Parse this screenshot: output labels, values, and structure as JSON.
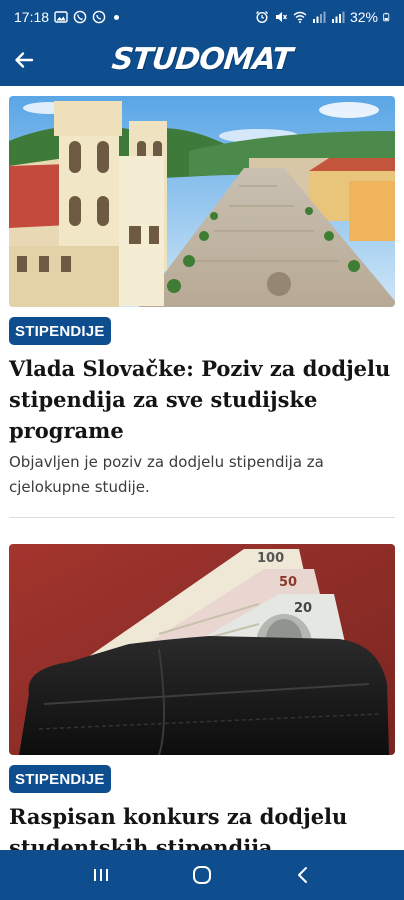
{
  "status_bar": {
    "time": "17:18",
    "battery": "32%"
  },
  "app_bar": {
    "logo_text": "STUDOMAT",
    "back_icon": "arrow-left-icon"
  },
  "articles": [
    {
      "category": "STIPENDIJE",
      "title": "Vlada Slovačke: Poziv za dodjelu stipendija za sve studijske programe",
      "excerpt": "Objavljen je poziv za dodjelu stipendija za cjelokupne studije.",
      "image": "town-square-photo"
    },
    {
      "category": "STIPENDIJE",
      "title": "Raspisan konkurs za dodjelu studentskih stipendija",
      "excerpt": "",
      "image": "wallet-banknotes-photo"
    }
  ],
  "nav_bar": {
    "recents_icon": "recent-apps-icon",
    "home_icon": "home-icon",
    "back_icon": "back-chevron-icon"
  },
  "colors": {
    "brand_blue": "#0e4e8f",
    "headline": "#141414",
    "excerpt": "#3c3c3c"
  }
}
